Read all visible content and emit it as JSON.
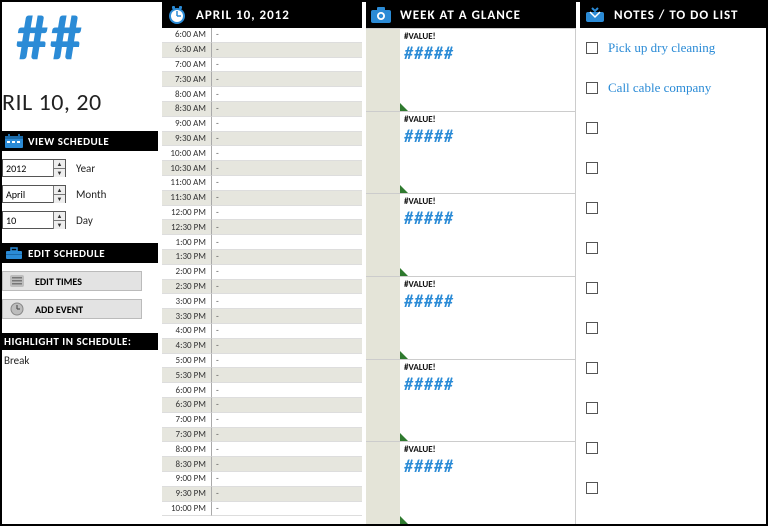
{
  "colors": {
    "accent": "#2b8bd6",
    "black": "#000000"
  },
  "sidebar": {
    "big_hash": "##",
    "big_date": "RIL 10, 20",
    "view_header": "VIEW SCHEDULE",
    "year": {
      "value": "2012",
      "label": "Year"
    },
    "month": {
      "value": "April",
      "label": "Month"
    },
    "day": {
      "value": "10",
      "label": "Day"
    },
    "edit_header": "EDIT SCHEDULE",
    "btn_edit_times": "EDIT TIMES",
    "btn_add_event": "ADD EVENT",
    "highlight_header": "HIGHLIGHT IN SCHEDULE:",
    "highlight_value": "Break"
  },
  "schedule": {
    "title": "APRIL 10, 2012",
    "rows": [
      {
        "t": "6:00 AM",
        "v": "-",
        "shade": false
      },
      {
        "t": "6:30 AM",
        "v": "-",
        "shade": true
      },
      {
        "t": "7:00 AM",
        "v": "-",
        "shade": false
      },
      {
        "t": "7:30 AM",
        "v": "-",
        "shade": true
      },
      {
        "t": "8:00 AM",
        "v": "-",
        "shade": false
      },
      {
        "t": "8:30 AM",
        "v": "-",
        "shade": true
      },
      {
        "t": "9:00 AM",
        "v": "-",
        "shade": false
      },
      {
        "t": "9:30 AM",
        "v": "-",
        "shade": true
      },
      {
        "t": "10:00 AM",
        "v": "-",
        "shade": false
      },
      {
        "t": "10:30 AM",
        "v": "-",
        "shade": true
      },
      {
        "t": "11:00 AM",
        "v": "-",
        "shade": false
      },
      {
        "t": "11:30 AM",
        "v": "-",
        "shade": true
      },
      {
        "t": "12:00 PM",
        "v": "-",
        "shade": false
      },
      {
        "t": "12:30 PM",
        "v": "-",
        "shade": true
      },
      {
        "t": "1:00 PM",
        "v": "-",
        "shade": false
      },
      {
        "t": "1:30 PM",
        "v": "-",
        "shade": true
      },
      {
        "t": "2:00 PM",
        "v": "-",
        "shade": false
      },
      {
        "t": "2:30 PM",
        "v": "-",
        "shade": true
      },
      {
        "t": "3:00 PM",
        "v": "-",
        "shade": false
      },
      {
        "t": "3:30 PM",
        "v": "-",
        "shade": true
      },
      {
        "t": "4:00 PM",
        "v": "-",
        "shade": false
      },
      {
        "t": "4:30 PM",
        "v": "-",
        "shade": true
      },
      {
        "t": "5:00 PM",
        "v": "-",
        "shade": false
      },
      {
        "t": "5:30 PM",
        "v": "-",
        "shade": true
      },
      {
        "t": "6:00 PM",
        "v": "-",
        "shade": false
      },
      {
        "t": "6:30 PM",
        "v": "-",
        "shade": true
      },
      {
        "t": "7:00 PM",
        "v": "-",
        "shade": false
      },
      {
        "t": "7:30 PM",
        "v": "-",
        "shade": true
      },
      {
        "t": "8:00 PM",
        "v": "-",
        "shade": false
      },
      {
        "t": "8:30 PM",
        "v": "-",
        "shade": true
      },
      {
        "t": "9:00 PM",
        "v": "-",
        "shade": false
      },
      {
        "t": "9:30 PM",
        "v": "-",
        "shade": true
      },
      {
        "t": "10:00 PM",
        "v": "-",
        "shade": false
      }
    ]
  },
  "week": {
    "title": "WEEK AT A GLANCE",
    "days": [
      {
        "err": "#VALUE!",
        "hash": "#####"
      },
      {
        "err": "#VALUE!",
        "hash": "#####"
      },
      {
        "err": "#VALUE!",
        "hash": "#####"
      },
      {
        "err": "#VALUE!",
        "hash": "#####"
      },
      {
        "err": "#VALUE!",
        "hash": "#####"
      },
      {
        "err": "#VALUE!",
        "hash": "#####"
      }
    ]
  },
  "notes": {
    "title": "NOTES / TO DO LIST",
    "items": [
      {
        "text": "Pick up dry cleaning"
      },
      {
        "text": "Call cable company"
      },
      {
        "text": ""
      },
      {
        "text": ""
      },
      {
        "text": ""
      },
      {
        "text": ""
      },
      {
        "text": ""
      },
      {
        "text": ""
      },
      {
        "text": ""
      },
      {
        "text": ""
      },
      {
        "text": ""
      },
      {
        "text": ""
      }
    ]
  }
}
